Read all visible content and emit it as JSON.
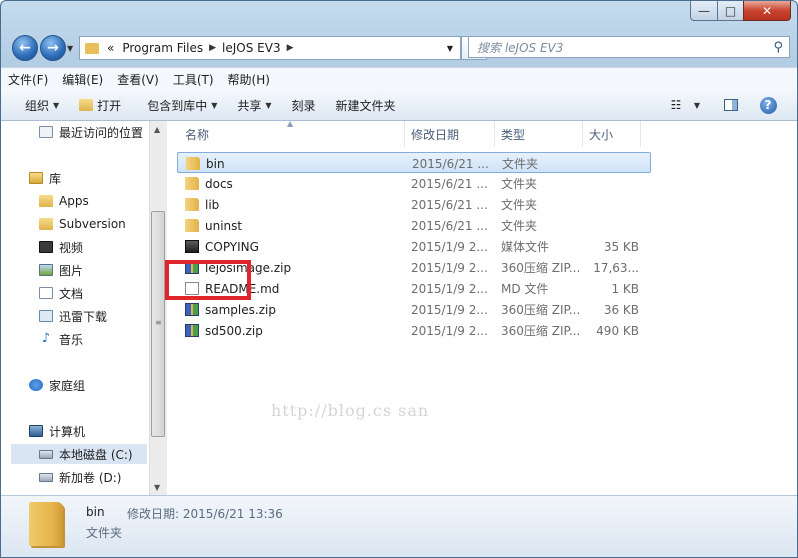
{
  "titlebar": {
    "min": "—",
    "max": "□",
    "close": "✕"
  },
  "address": {
    "overflow": "«",
    "crumbs": [
      "Program Files",
      "leJOS EV3"
    ],
    "refresh_icon": "refresh-icon"
  },
  "search": {
    "placeholder": "搜索 leJOS EV3",
    "icon": "search-icon"
  },
  "menu": [
    "文件(F)",
    "编辑(E)",
    "查看(V)",
    "工具(T)",
    "帮助(H)"
  ],
  "toolbar": {
    "organize": "组织",
    "open": "打开",
    "include": "包含到库中",
    "share": "共享",
    "burn": "刻录",
    "new_folder": "新建文件夹"
  },
  "nav": {
    "recent": "最近访问的位置",
    "library": "库",
    "apps": "Apps",
    "subversion": "Subversion",
    "video": "视频",
    "pictures": "图片",
    "documents": "文档",
    "downloads": "迅雷下载",
    "music": "音乐",
    "homegroup": "家庭组",
    "computer": "计算机",
    "disk_c": "本地磁盘 (C:)",
    "disk_d": "新加卷 (D:)"
  },
  "columns": {
    "name": "名称",
    "date": "修改日期",
    "type": "类型",
    "size": "大小"
  },
  "files": [
    {
      "name": "bin",
      "date": "2015/6/21 ...",
      "type": "文件夹",
      "size": "",
      "icon": "folder"
    },
    {
      "name": "docs",
      "date": "2015/6/21 ...",
      "type": "文件夹",
      "size": "",
      "icon": "folder"
    },
    {
      "name": "lib",
      "date": "2015/6/21 ...",
      "type": "文件夹",
      "size": "",
      "icon": "folder"
    },
    {
      "name": "uninst",
      "date": "2015/6/21 ...",
      "type": "文件夹",
      "size": "",
      "icon": "folder"
    },
    {
      "name": "COPYING",
      "date": "2015/1/9 2...",
      "type": "媒体文件",
      "size": "35 KB",
      "icon": "media"
    },
    {
      "name": "lejosimage.zip",
      "date": "2015/1/9 2...",
      "type": "360压缩 ZIP...",
      "size": "17,63...",
      "icon": "zip"
    },
    {
      "name": "README.md",
      "date": "2015/1/9 2...",
      "type": "MD 文件",
      "size": "1 KB",
      "icon": "md"
    },
    {
      "name": "samples.zip",
      "date": "2015/1/9 2...",
      "type": "360压缩 ZIP...",
      "size": "36 KB",
      "icon": "zip"
    },
    {
      "name": "sd500.zip",
      "date": "2015/1/9 2...",
      "type": "360压缩 ZIP...",
      "size": "490 KB",
      "icon": "zip"
    }
  ],
  "selected_index": 0,
  "watermark": "http://blog.cs           san",
  "details": {
    "name": "bin",
    "meta": "修改日期: 2015/6/21 13:36",
    "type": "文件夹"
  },
  "colors": {
    "highlight": "#e0262a",
    "selection": "#cfe3f7"
  }
}
